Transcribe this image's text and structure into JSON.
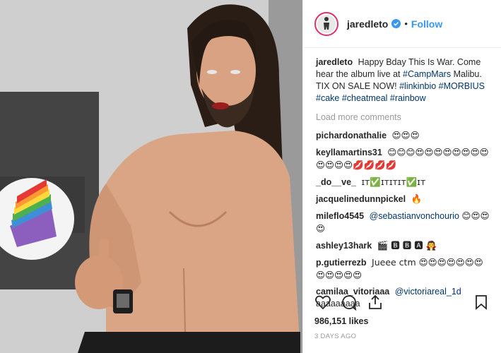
{
  "post": {
    "username": "jaredleto",
    "follow_label": "Follow",
    "caption_user": "jaredleto",
    "caption_text": "Happy Bday This Is War. Come hear the album live at",
    "caption_link": "#CampMars",
    "caption_text2": "Malibu. TIX ON SALE NOW!",
    "caption_tags": "#linkinbio #MORBIUS #cake #cheatmeal #rainbow",
    "load_more": "Load more comments",
    "likes": "986,151 likes",
    "time": "3 DAYS AGO"
  },
  "comments": [
    {
      "user": "pichardonathalie",
      "text": "😍😍😍"
    },
    {
      "user": "keyllamartins31",
      "text": "😊😊😊😍😍😍😍😍😍😍😍😍😍😍😍💋💋💋💋"
    },
    {
      "user": "_do__ve_",
      "text": "ɪᴛ✅ɪᴛɪᴛɪᴛ✅ɪᴛ"
    },
    {
      "user": "jacquelinedunnpickel",
      "text": "🔥"
    },
    {
      "user": "mileflo4545",
      "mention": "@sebastianvonchourio",
      "text": "😊😍😍😍"
    },
    {
      "user": "ashley13hark",
      "text": "🎬 🅱 🅱 🅰 🧛"
    },
    {
      "user": "p.gutierrezb",
      "text": "Jueee ctm 😍😍😍😍😍😍😍😍😍😍😍😍"
    },
    {
      "user": "camilaa_vitoriaaa",
      "mention": "@victoriareal_1d",
      "text": "aaaaaaaaa"
    }
  ],
  "colors": {
    "accent": "#3897f0",
    "text": "#262626",
    "muted": "#999999"
  }
}
